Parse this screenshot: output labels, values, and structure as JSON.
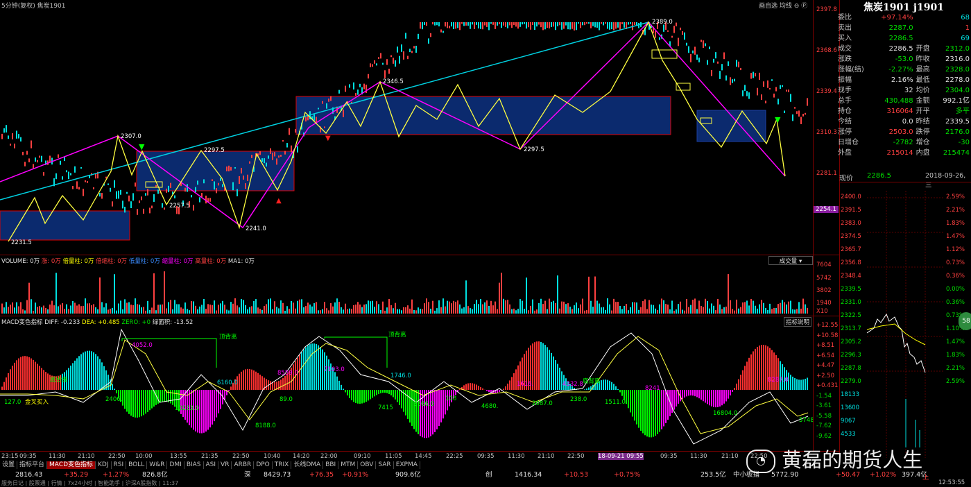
{
  "header": {
    "left_title": "5分钟(复权) 焦炭1901",
    "right_links": [
      "画自选",
      "均线",
      "⊖",
      "Ⓟ"
    ]
  },
  "quote_panel": {
    "title": "焦炭1901 j1901",
    "rows": [
      {
        "l": "委比",
        "lv": "+97.14%",
        "r": "",
        "rv": "68"
      },
      {
        "l": "卖出",
        "lv": "2287.0",
        "r": "",
        "rv": "1"
      },
      {
        "l": "买入",
        "lv": "2286.5",
        "r": "",
        "rv": "69"
      },
      {
        "l": "成交",
        "lv": "2286.5",
        "r": "开盘",
        "rv": "2312.0"
      },
      {
        "l": "涨跌",
        "lv": "-53.0",
        "r": "昨收",
        "rv": "2316.0"
      },
      {
        "l": "涨幅(结)",
        "lv": "-2.27%",
        "r": "最高",
        "rv": "2328.0"
      },
      {
        "l": "振幅",
        "lv": "2.16%",
        "r": "最低",
        "rv": "2278.0"
      },
      {
        "l": "现手",
        "lv": "32",
        "r": "均价",
        "rv": "2304.0"
      },
      {
        "l": "总手",
        "lv": "430,488",
        "r": "金额",
        "rv": "992.1亿"
      },
      {
        "l": "持仓",
        "lv": "316064",
        "r": "开平",
        "rv": "多平"
      },
      {
        "l": "今结",
        "lv": "0.0",
        "r": "昨结",
        "rv": "2339.5"
      },
      {
        "l": "涨停",
        "lv": "2503.0",
        "r": "跌停",
        "rv": "2176.0"
      },
      {
        "l": "日增仓",
        "lv": "-2782",
        "r": "增仓",
        "rv": "-30"
      },
      {
        "l": "外盘",
        "lv": "215014",
        "r": "内盘",
        "rv": "215474"
      }
    ],
    "now_label": "现价",
    "now_value": "2286.5",
    "date": "2018-09-26,三"
  },
  "main_axis": [
    "2397.8",
    "2368.6",
    "2339.4",
    "2310.3",
    "2281.1",
    "2254.1"
  ],
  "annotations": [
    "2389.0",
    "2346.5",
    "2307.0",
    "2297.5",
    "2297.5",
    "2257.5",
    "2241.0",
    "2231.5"
  ],
  "volume": {
    "label": "VOLUME: 0万",
    "items": [
      "涨: 0万",
      "倍量柱: 0万",
      "倍缩柱: 0万",
      "低量柱: 0万",
      "缩量柱: 0万",
      "高量柱: 0万",
      "MA1: 0万"
    ],
    "select": "成交量",
    "axis": [
      "7604",
      "5742",
      "3802",
      "1940",
      "X10"
    ]
  },
  "macd": {
    "label": "MACD变色指标",
    "diff": "DIFF: -0.233",
    "dea": "DEA: +0.485",
    "zero": "ZERO: +0",
    "bar": "绿面积: -13.52",
    "help": "指标说明",
    "axis": [
      "+12.55",
      "+10.58",
      "+8.51",
      "+6.54",
      "+4.47",
      "+2.50",
      "+0.431",
      "-1.54",
      "-3.61",
      "-5.58",
      "-7.62",
      "-9.62"
    ],
    "notes": [
      "顶背离",
      "顶背离",
      "底背离",
      "底背离",
      "金叉买入"
    ],
    "nums": [
      "4052.0",
      "6160.0",
      "8559.0",
      "7103.0",
      "1746.0",
      "1616.",
      "4332.8",
      "8241",
      "8287.0",
      "10233.0",
      "2406.",
      "89.0",
      "7415",
      "3566.0",
      "108",
      "4680.",
      "2087.0",
      "238.0",
      "1511.0",
      "16804.0",
      "8188.0",
      "5748.0",
      "127.0"
    ]
  },
  "time_axis": [
    "23:15",
    "09:35",
    "11:30",
    "21:10",
    "22:50",
    "10:00",
    "13:55",
    "21:35",
    "22:50",
    "10:40",
    "14:20",
    "22:00",
    "09:10",
    "11:05",
    "14:45",
    "22:25",
    "09:35",
    "11:30",
    "21:10",
    "22:50",
    "18-09-21 09:55",
    "09:35",
    "11:30",
    "21:10",
    "22:50"
  ],
  "tabs": [
    "设置",
    "指标平台",
    "MACD变色指标",
    "KDJ",
    "RSI",
    "BOLL",
    "W&R",
    "DMI",
    "BIAS",
    "ASI",
    "VR",
    "ARBR",
    "DPO",
    "TRIX",
    "长线DMA",
    "BBI",
    "MTM",
    "OBV",
    "SAR",
    "EXPMA"
  ],
  "status": [
    "2816.43",
    "+35.29",
    "+1.27%",
    "826.8亿",
    "深",
    "8429.73",
    "+76.35",
    "+0.91%",
    "909.6亿",
    "创",
    "1416.34",
    "+10.53",
    "+0.75%",
    "253.5亿",
    "中小板指",
    "5772.90",
    "+50.47",
    "+1.02%",
    "397.4亿"
  ],
  "status_extra": {
    "sh": "上",
    "clock": "12:53:55"
  },
  "ticker_tail": "服务日记 | 股票通 | 行情 | 7x24小时 | 智能助手 | 沪深A股指数 | 11:37",
  "watermark": "黄磊的期货人生",
  "mini_chart": {
    "left_axis": [
      "2400.0",
      "2391.5",
      "2383.0",
      "2374.5",
      "2365.7",
      "2356.8",
      "2348.4",
      "2339.5",
      "2331.0",
      "2322.5",
      "2313.7",
      "2305.2",
      "2296.3",
      "2287.8",
      "2279.0",
      "18133",
      "13600",
      "9067",
      "4533"
    ],
    "right_axis": [
      "2.59%",
      "2.21%",
      "1.83%",
      "1.47%",
      "1.12%",
      "0.73%",
      "0.36%",
      "0.00%",
      "0.36%",
      "0.73%",
      "1.10%",
      "1.47%",
      "1.83%",
      "2.21%",
      "2.59%"
    ],
    "bubble": "58"
  },
  "colors": {
    "up": "#ff4040",
    "down": "#00e000",
    "accent_magenta": "#ff00ff",
    "trend_cyan": "#00d0e0",
    "zig": "#ffff40",
    "box_fill": "#0b2a6e"
  }
}
